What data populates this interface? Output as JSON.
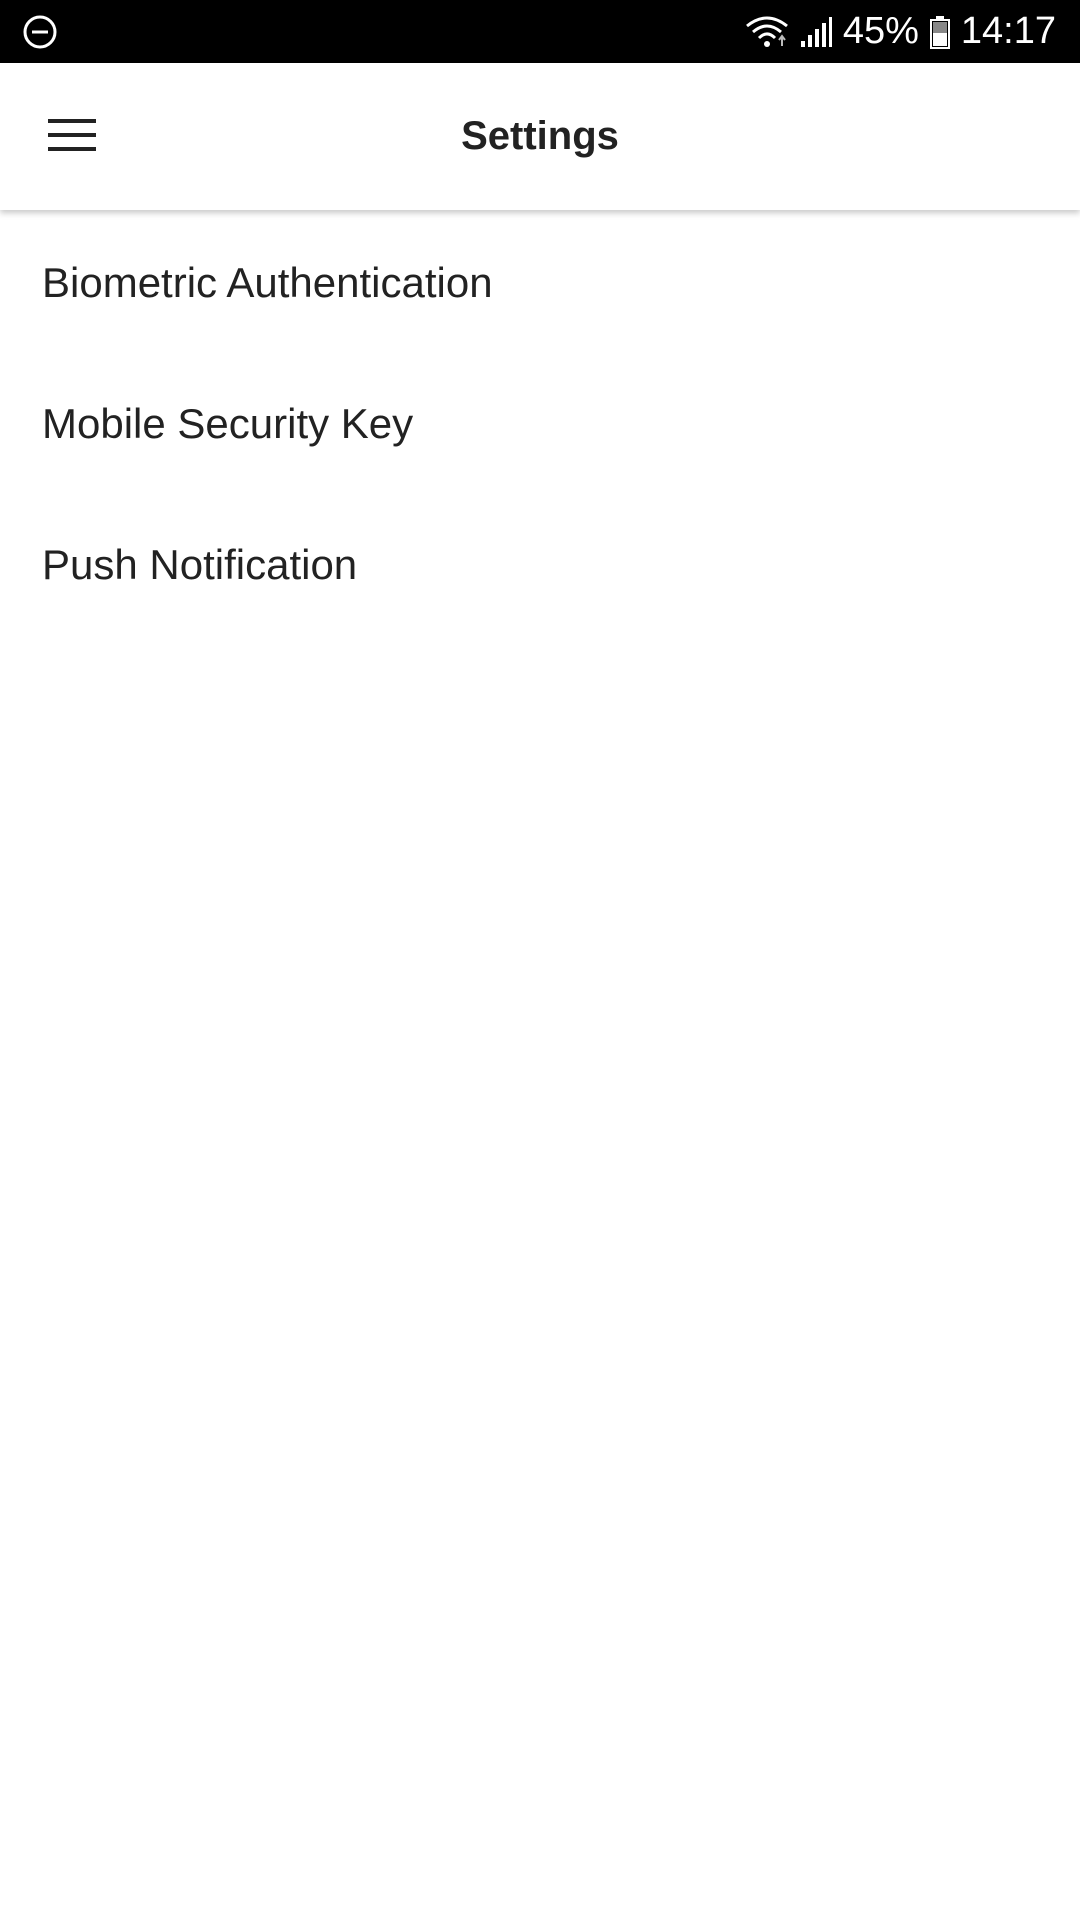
{
  "status_bar": {
    "left_icon": "do-not-disturb-icon",
    "wifi_icon": "wifi-icon",
    "signal_icon": "cell-signal-icon",
    "battery_percent": "45%",
    "battery_icon": "battery-icon",
    "time": "14:17"
  },
  "app_bar": {
    "menu_icon": "hamburger-menu-icon",
    "title": "Settings"
  },
  "settings": {
    "items": [
      {
        "label": "Biometric Authentication"
      },
      {
        "label": "Mobile Security Key"
      },
      {
        "label": "Push Notification"
      }
    ]
  },
  "colors": {
    "status_bar_bg": "#000000",
    "app_bar_bg": "#ffffff",
    "text_primary": "#222222"
  }
}
